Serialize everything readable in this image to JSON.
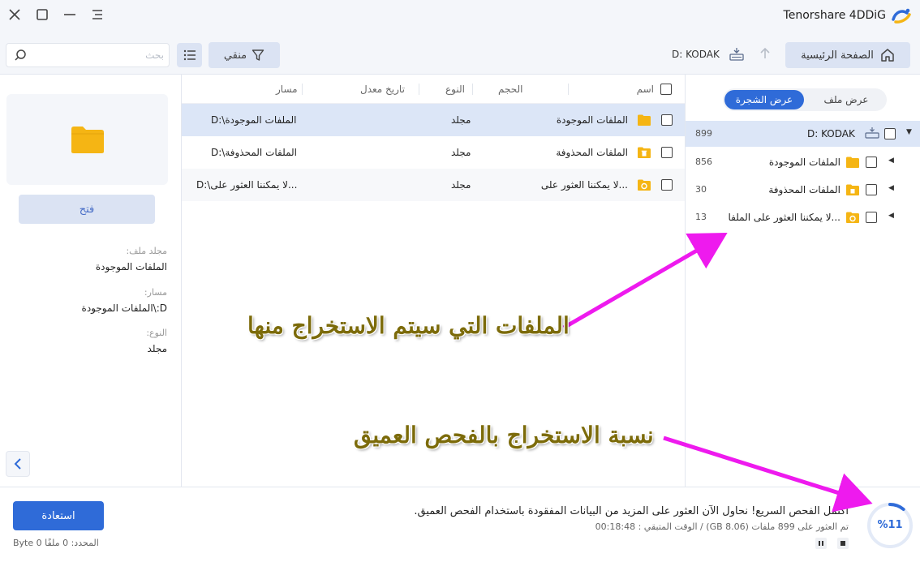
{
  "app": {
    "brand": "Tenorshare 4DDiG"
  },
  "toolbar": {
    "search_placeholder": "بحث",
    "filter_label": "منقي",
    "drive_label": "D: KODAK",
    "home_label": "الصفحة الرئيسية"
  },
  "preview": {
    "open_label": "فتح",
    "fields": [
      {
        "key": "مجلد ملف:",
        "value": "الملفات الموجودة"
      },
      {
        "key": "مسار:",
        "value": "D:\\الملفات الموجودة"
      },
      {
        "key": "النوع:",
        "value": "مجلد"
      }
    ]
  },
  "table": {
    "headers": {
      "name": "اسم",
      "size": "الحجم",
      "type": "النوع",
      "modified": "تاريخ معدل",
      "path": "مسار"
    },
    "rows": [
      {
        "name": "الملفات الموجودة",
        "size": "",
        "type": "مجلد",
        "modified": "",
        "path": "D:\\الملفات الموجودة",
        "icon": "folder-icon"
      },
      {
        "name": "الملفات المحذوفة",
        "size": "",
        "type": "مجلد",
        "modified": "",
        "path": "D:\\الملفات المحذوفة",
        "icon": "deleted-folder-icon"
      },
      {
        "name": "لا يمكننا العثور على...",
        "size": "",
        "type": "مجلد",
        "modified": "",
        "path": "D:\\لا يمكننا العثور على...",
        "icon": "lost-folder-icon"
      }
    ]
  },
  "tree": {
    "tab_tree": "عرض الشجرة",
    "tab_file": "عرض ملف",
    "root": {
      "label": "D: KODAK",
      "count": "899"
    },
    "items": [
      {
        "label": "الملفات الموجودة",
        "count": "856"
      },
      {
        "label": "الملفات المحذوفة",
        "count": "30"
      },
      {
        "label": "لا يمكننا العثور على الملفا...",
        "count": "13"
      }
    ]
  },
  "annotations": {
    "top": "الملفات التي سيتم الاستخراج منها",
    "bottom": "نسبة الاستخراج بالفحص العميق"
  },
  "footer": {
    "recover_label": "استعادة",
    "selected_info": "المحدد: 0 ملفًا 0 Byte",
    "status_main": "اكتمل الفحص السريع! نحاول الآن العثور على المزيد من البيانات المفقودة باستخدام الفحص العميق.",
    "status_sub": "تم العثور على 899 ملفات (GB 8.06)  /  الوقت المتبقي : 00:18:48",
    "progress_label": "%11",
    "progress_fraction": 0.11
  },
  "colors": {
    "accent": "#2f6bd8",
    "folder": "#f5b514",
    "annotation_arrow": "#ee1aee"
  }
}
